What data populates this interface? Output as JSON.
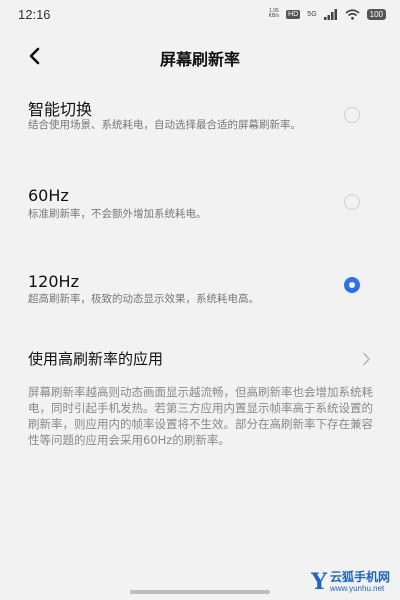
{
  "status_bar": {
    "time": "12:16",
    "net_speed": "1.95",
    "net_speed_unit": "KB/s",
    "hd_badge": "HD",
    "signal_label": "5G",
    "battery": "100"
  },
  "nav": {
    "title": "屏幕刷新率"
  },
  "options": [
    {
      "title": "智能切换",
      "description": "结合使用场景、系统耗电，自动选择最合适的屏幕刷新率。",
      "selected": false
    },
    {
      "title": "60Hz",
      "description": "标准刷新率，不会额外增加系统耗电。",
      "selected": false
    },
    {
      "title": "120Hz",
      "description": "超高刷新率，极致的动态显示效果，系统耗电高。",
      "selected": true
    }
  ],
  "apps_row": {
    "label": "使用高刷新率的应用"
  },
  "note": "屏幕刷新率越高则动态画面显示越流畅，但高刷新率也会增加系统耗电，同时引起手机发热。若第三方应用内置显示帧率高于系统设置的刷新率，则应用内的帧率设置将不生效。部分在高刷新率下存在兼容性等问题的应用会采用60Hz的刷新率。",
  "watermark": {
    "logo_letter": "Y",
    "name": "云狐手机网",
    "url": "www.yunhu.net"
  },
  "colors": {
    "accent": "#2f6ff0",
    "background": "#f2f2f2",
    "watermark": "#1e63c8"
  }
}
